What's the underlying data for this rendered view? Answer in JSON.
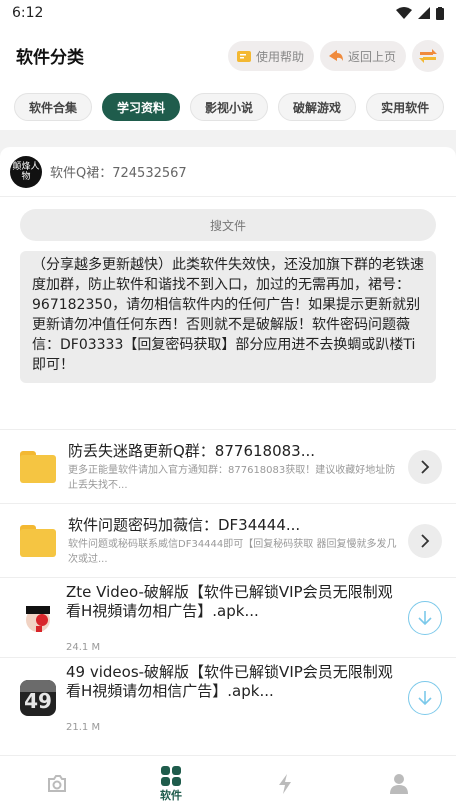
{
  "status": {
    "time": "6:12"
  },
  "header": {
    "title": "软件分类",
    "help_label": "使用帮助",
    "back_label": "返回上页"
  },
  "tabs": [
    {
      "label": "软件合集",
      "active": false
    },
    {
      "label": "学习资料",
      "active": true
    },
    {
      "label": "影视小说",
      "active": false
    },
    {
      "label": "破解游戏",
      "active": false
    },
    {
      "label": "实用软件",
      "active": false
    }
  ],
  "qq": {
    "avatar_text": "颠烽人物",
    "text": "软件Q裙：724532567"
  },
  "search": {
    "placeholder": "搜文件"
  },
  "notice": "（分享越多更新越快）此类软件失效快，还没加旗下群的老铁速度加群，防止软件和谐找不到入口，加过的无需再加，裙号：967182350，请勿相信软件内的任何广告！如果提示更新就别更新请勿冲值任何东西！否则就不是破解版！软件密码问题薇信：DF03333【回复密码获取】部分应用进不去换蜩或趴楼Ti即可！",
  "folders": [
    {
      "title": "防丢失迷路更新Q群：877618083...",
      "sub": "更多正能量软件请加入官方通知群：877618083获取！建议收藏好地址防止丢失找不..."
    },
    {
      "title": "软件问题密码加薇信：DF34444...",
      "sub": "软件问题或秘码联系威信DF34444即可【回复秘码获取 器回复慢就多发几次或过..."
    }
  ],
  "files": [
    {
      "title": "Zte Video-破解版【软件已解锁VIP会员无限制观看H視頻请勿相广告】.apk...",
      "size": "24.1 M",
      "icon": "zte-video-app-icon"
    },
    {
      "title": "49 videos-破解版【软件已解锁VIP会员无限制观看H視頻请勿相信广告】.apk...",
      "size": "21.1 M",
      "icon": "49-videos-app-icon"
    }
  ],
  "bottom_nav": {
    "software_label": "软件"
  },
  "colors": {
    "accent": "#1f5c4c",
    "download": "#7cc9ea",
    "folder": "#f5c542"
  }
}
